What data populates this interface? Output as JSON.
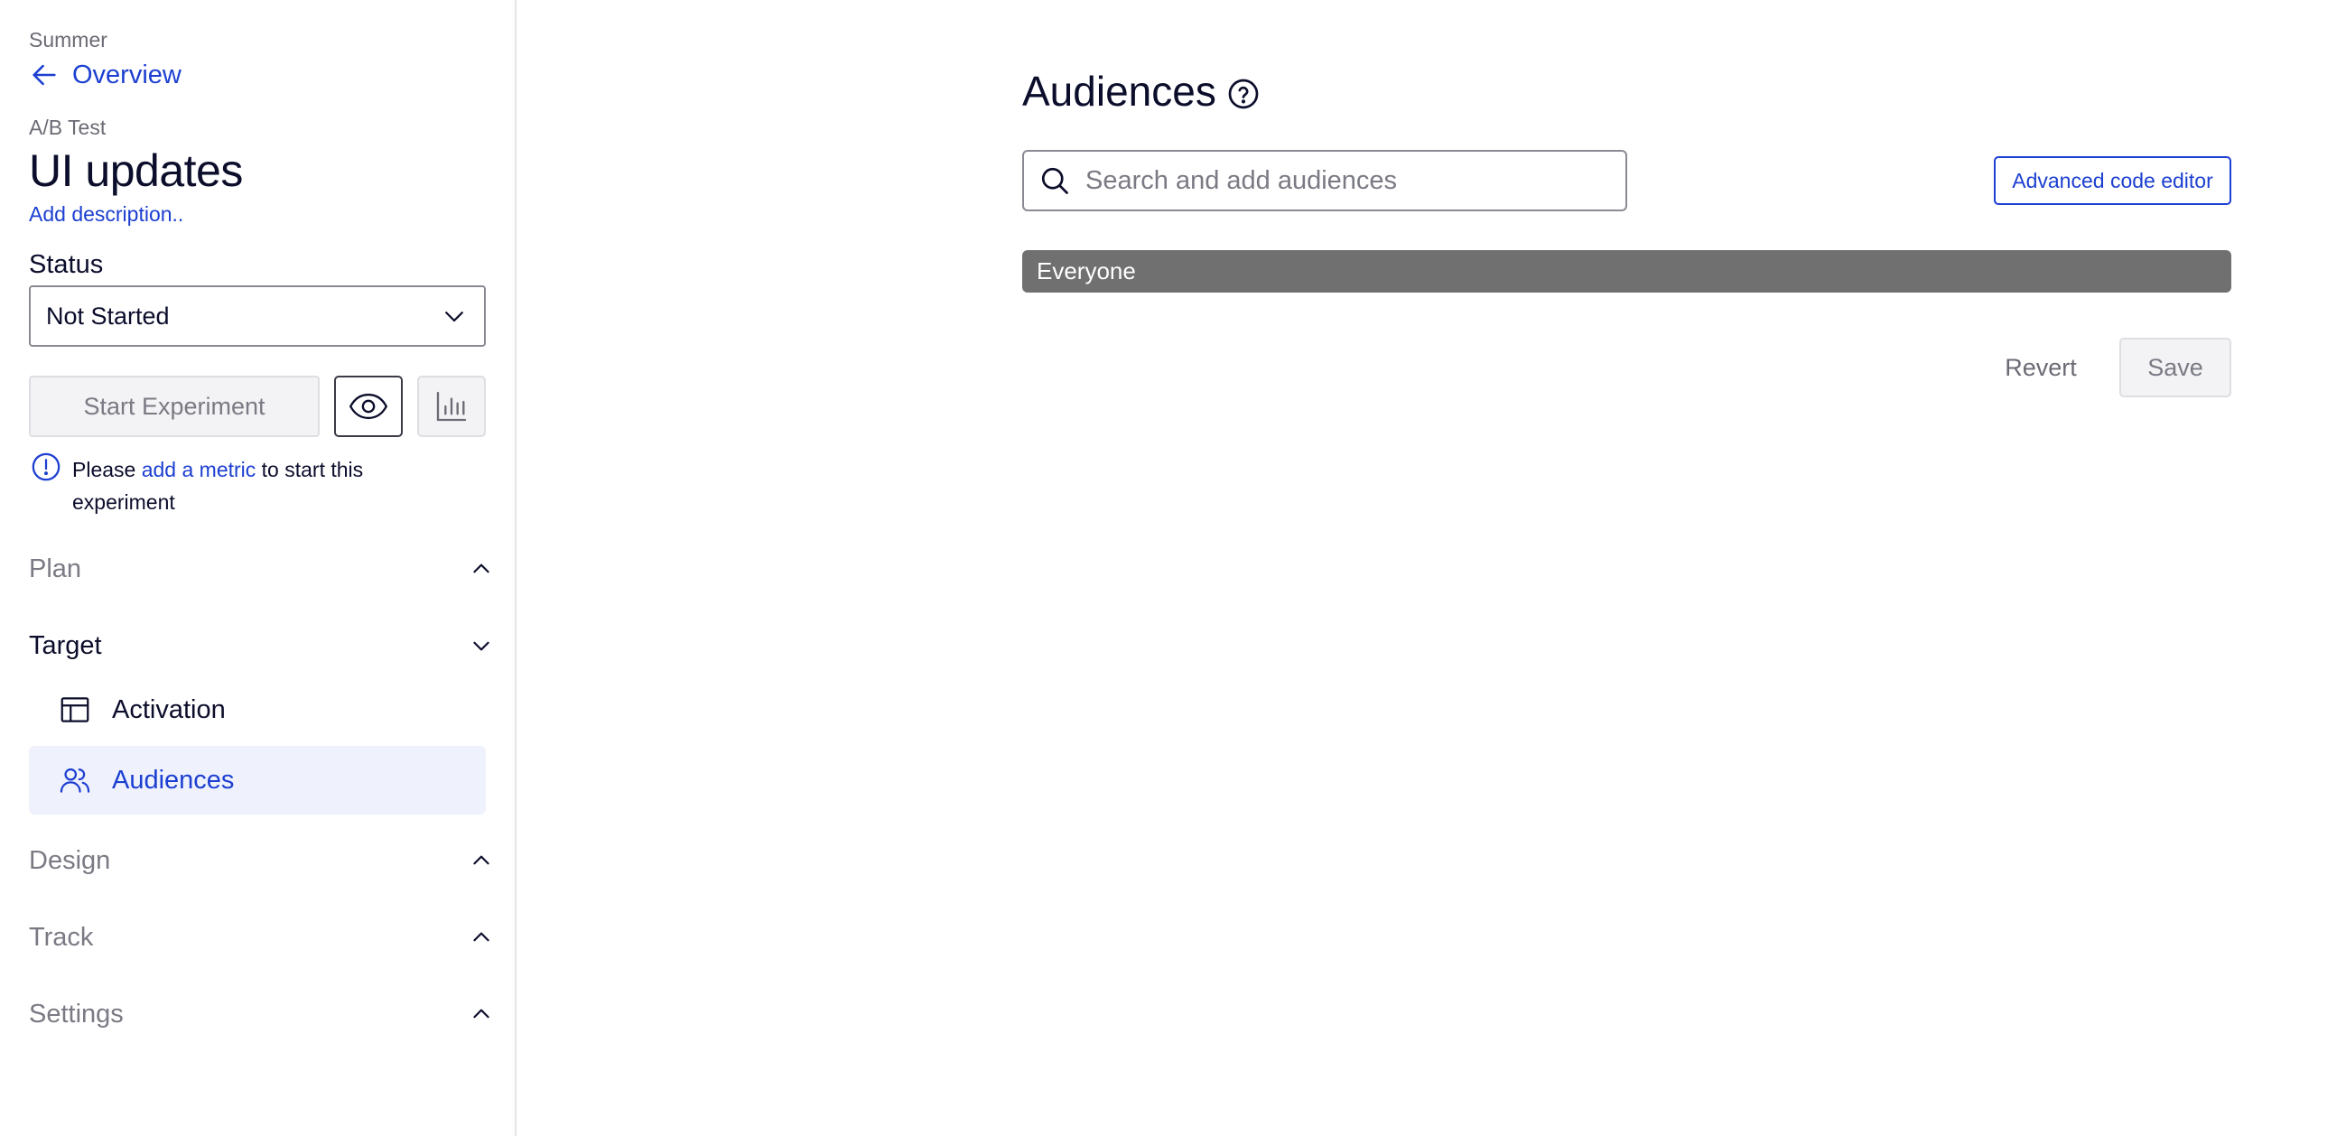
{
  "sidebar": {
    "project": "Summer",
    "back_label": "Overview",
    "experiment_type": "A/B Test",
    "experiment_title": "UI updates",
    "add_description": "Add description..",
    "status_label": "Status",
    "status_value": "Not Started",
    "start_button": "Start Experiment",
    "notice": {
      "prefix": "Please",
      "link": "add a metric",
      "suffix": "to start this experiment"
    },
    "sections": {
      "plan": "Plan",
      "target": "Target",
      "design": "Design",
      "track": "Track",
      "settings": "Settings"
    },
    "target_items": {
      "activation": "Activation",
      "audiences": "Audiences"
    }
  },
  "main": {
    "title": "Audiences",
    "search_placeholder": "Search and add audiences",
    "advanced_code_editor": "Advanced code editor",
    "audience_condition": "Everyone",
    "revert_button": "Revert",
    "save_button": "Save"
  },
  "icons": {
    "back": "arrow-left-icon",
    "status": "chevron-down-icon",
    "preview": "eye-icon",
    "results": "bar-chart-icon",
    "notice": "info-circle-icon",
    "help": "question-circle-icon",
    "search": "search-icon",
    "activation": "layout-icon",
    "audiences": "users-icon"
  },
  "colors": {
    "accent": "#1c3fd1",
    "selected_bg": "#eff1fd",
    "audience_bar": "#707070"
  }
}
